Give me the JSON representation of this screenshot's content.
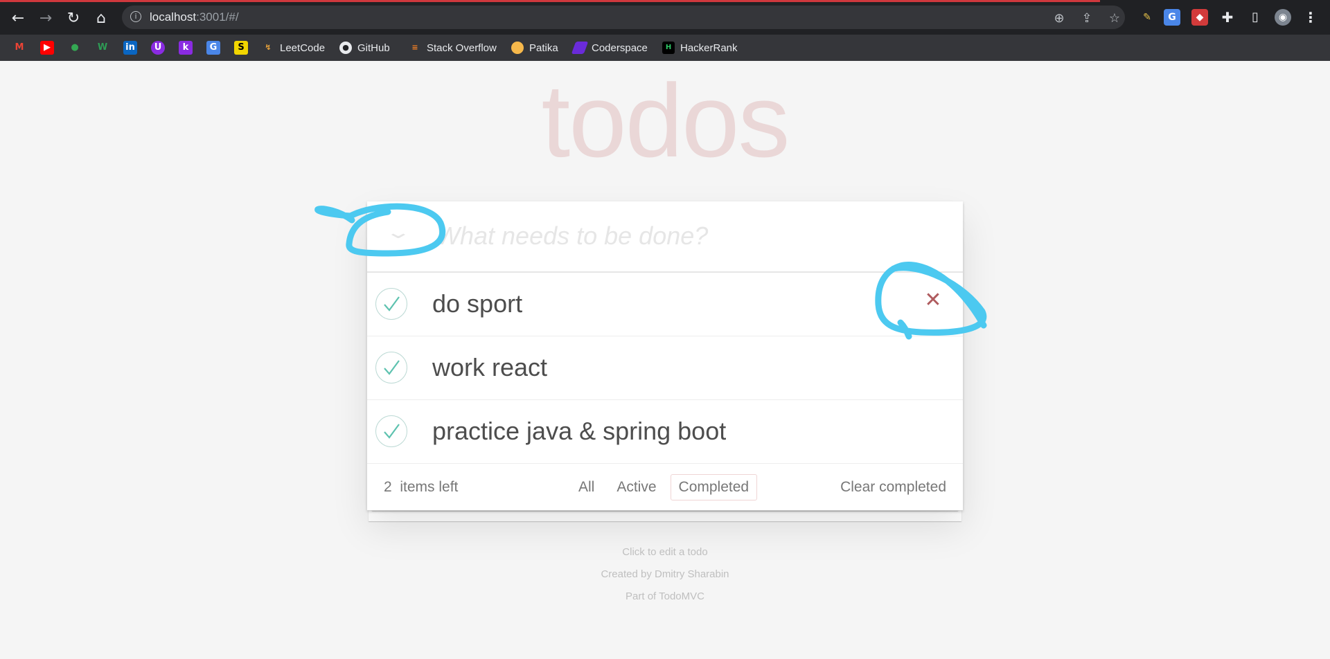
{
  "browser": {
    "url_host": "localhost",
    "url_rest": ":3001/#/",
    "bookmarks": [
      {
        "label": "LeetCode"
      },
      {
        "label": "GitHub"
      },
      {
        "label": "Stack Overflow"
      },
      {
        "label": "Patika"
      },
      {
        "label": "Coderspace"
      },
      {
        "label": "HackerRank"
      }
    ]
  },
  "app": {
    "title": "todos",
    "new_todo_placeholder": "What needs to be done?",
    "todos": [
      {
        "label": "do sport",
        "completed": true
      },
      {
        "label": "work react",
        "completed": true
      },
      {
        "label": "practice java & spring boot",
        "completed": true
      }
    ],
    "footer": {
      "count": "2",
      "count_suffix": "items left",
      "filters": [
        "All",
        "Active",
        "Completed"
      ],
      "selected_filter": "Completed",
      "clear_label": "Clear completed"
    },
    "info": [
      "Click to edit a todo",
      "Created by Dmitry Sharabin",
      "Part of TodoMVC"
    ]
  },
  "colors": {
    "accent": "#af2f2f",
    "check": "#5dc2af",
    "annotation": "#4cc9f0"
  }
}
